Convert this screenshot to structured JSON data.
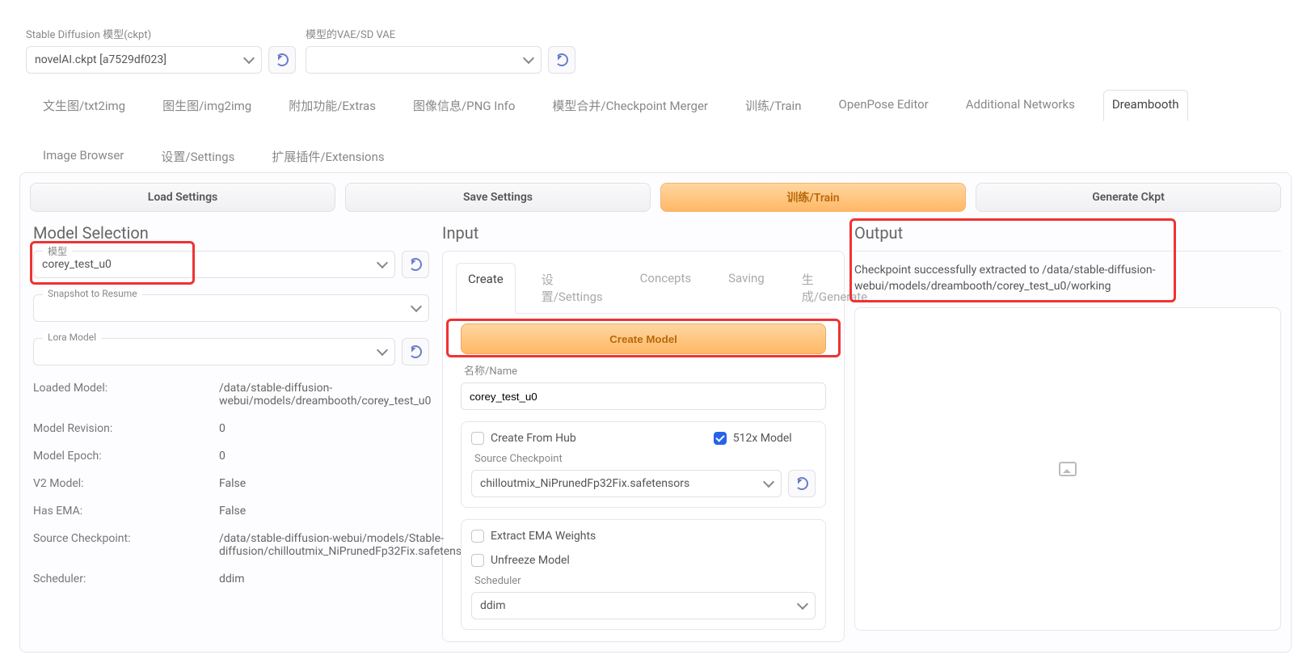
{
  "topbar": {
    "sd_model_label": "Stable Diffusion 模型(ckpt)",
    "sd_model_value": "novelAI.ckpt [a7529df023]",
    "vae_label": "模型的VAE/SD VAE",
    "vae_value": ""
  },
  "tabs": [
    "文生图/txt2img",
    "图生图/img2img",
    "附加功能/Extras",
    "图像信息/PNG Info",
    "模型合并/Checkpoint Merger",
    "训练/Train",
    "OpenPose Editor",
    "Additional Networks",
    "Dreambooth",
    "Image Browser",
    "设置/Settings",
    "扩展插件/Extensions"
  ],
  "active_tab": 8,
  "toolbar": {
    "load": "Load Settings",
    "save": "Save Settings",
    "train": "训练/Train",
    "gen": "Generate Ckpt"
  },
  "model_sel": {
    "title": "Model Selection",
    "model_label": "模型",
    "model_value": "corey_test_u0",
    "snapshot_label": "Snapshot to Resume",
    "snapshot_value": "",
    "lora_label": "Lora Model",
    "lora_value": "",
    "info": {
      "Loaded Model:": "/data/stable-diffusion-webui/models/dreambooth/corey_test_u0",
      "Model Revision:": "0",
      "Model Epoch:": "0",
      "V2 Model:": "False",
      "Has EMA:": "False",
      "Source Checkpoint:": "/data/stable-diffusion-webui/models/Stable-diffusion/chilloutmix_NiPrunedFp32Fix.safetens",
      "Scheduler:": "ddim"
    }
  },
  "input": {
    "title": "Input",
    "subtabs": [
      "Create",
      "设置/Settings",
      "Concepts",
      "Saving",
      "生成/Generate"
    ],
    "active_subtab": 0,
    "create_model_btn": "Create Model",
    "name_label": "名称/Name",
    "name_value": "corey_test_u0",
    "create_from_hub": "Create From Hub",
    "model_512": "512x Model",
    "source_ckpt_label": "Source Checkpoint",
    "source_ckpt_value": "chilloutmix_NiPrunedFp32Fix.safetensors",
    "extract_ema": "Extract EMA Weights",
    "unfreeze": "Unfreeze Model",
    "scheduler_label": "Scheduler",
    "scheduler_value": "ddim"
  },
  "output": {
    "title": "Output",
    "msg": "Checkpoint successfully extracted to /data/stable-diffusion-webui/models/dreambooth/corey_test_u0/working"
  }
}
